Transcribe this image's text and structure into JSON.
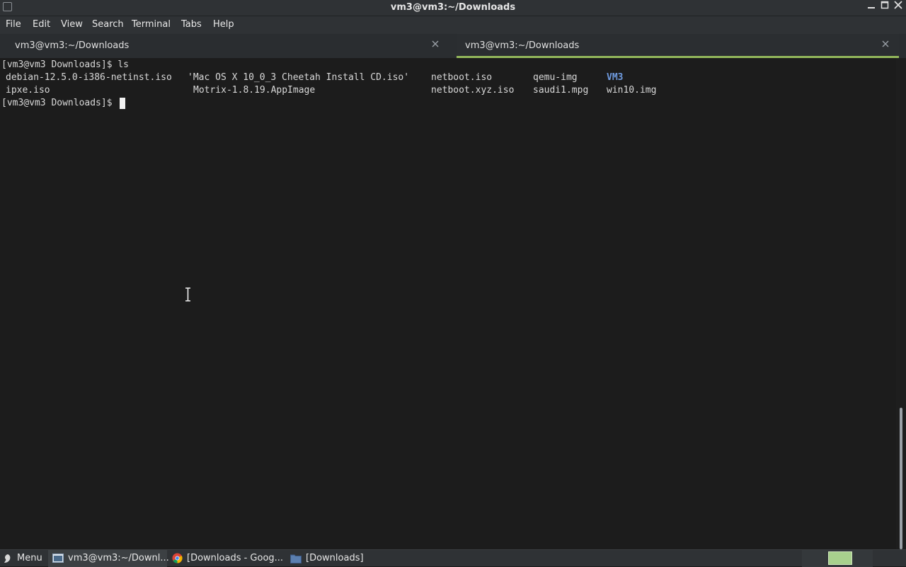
{
  "window": {
    "title": "vm3@vm3:~/Downloads",
    "controls": [
      "minimize-icon",
      "maximize-icon",
      "close-icon"
    ]
  },
  "menu": {
    "items": [
      "File",
      "Edit",
      "View",
      "Search",
      "Terminal",
      "Tabs",
      "Help"
    ]
  },
  "tabs": [
    {
      "label": "vm3@vm3:~/Downloads",
      "active": false
    },
    {
      "label": "vm3@vm3:~/Downloads",
      "active": true
    }
  ],
  "terminal": {
    "line1": "[vm3@vm3 Downloads]$ ls",
    "ls_row1": [
      "debian-12.5.0-i386-netinst.iso",
      "'Mac OS X 10_0_3 Cheetah Install CD.iso'",
      "netboot.iso",
      "qemu-img",
      "VM3"
    ],
    "ls_row2": [
      "ipxe.iso",
      "Motrix-1.8.19.AppImage",
      "netboot.xyz.iso",
      "saudi1.mpg",
      "win10.img"
    ],
    "prompt": "[vm3@vm3 Downloads]$ "
  },
  "taskbar": {
    "menu_label": "Menu",
    "items": [
      "vm3@vm3:~/Downl...",
      "[Downloads - Goog...",
      "[Downloads]"
    ]
  },
  "colors": {
    "directory": "#6f9be0",
    "active_tab_accent": "#93b75b",
    "workspace": "#a8d08d"
  }
}
